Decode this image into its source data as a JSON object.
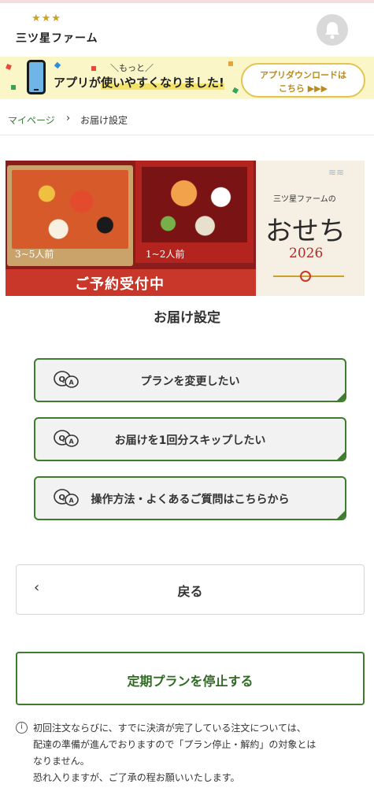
{
  "header": {
    "logo_stars": "★★★",
    "logo_text": "三ツ星ファーム"
  },
  "banner": {
    "sub": "＼もっと／",
    "main_prefix": "アプリが",
    "main_highlight": "使いやすくなりました!",
    "button_line1": "アプリダウンロードは",
    "button_line2": "こちら ▶▶▶"
  },
  "breadcrumb": {
    "home": "マイページ",
    "separator": "›",
    "current": "お届け設定"
  },
  "promo": {
    "label_large": "3~5人前",
    "label_small": "1~2人前",
    "band": "ご予約受付中",
    "brand": "三ツ星ファームの",
    "title": "おせち",
    "year": "2026"
  },
  "page": {
    "title": "お届け設定"
  },
  "options": [
    {
      "label": "プランを変更したい",
      "icon": "qa-icon"
    },
    {
      "label": "お届けを1回分スキップしたい",
      "icon": "qa-icon"
    },
    {
      "label": "操作方法・よくあるご質問はこちらから",
      "icon": "qa-icon"
    }
  ],
  "back": {
    "chevron": "‹",
    "label": "戻る"
  },
  "stop": {
    "label": "定期プランを停止する"
  },
  "notice": {
    "icon": "i",
    "line1": "初回注文ならびに、すでに決済が完了している注文については、",
    "line2": "配達の準備が進んでおりますので「プラン停止・解約」の対象とは",
    "line3": "なりません。",
    "line4": "恐れ入りますが、ご了承の程お願いいたします。"
  },
  "colors": {
    "accent_green": "#3e7c2e",
    "banner_bg": "#fbf6c7",
    "promo_red": "#c8372a"
  }
}
